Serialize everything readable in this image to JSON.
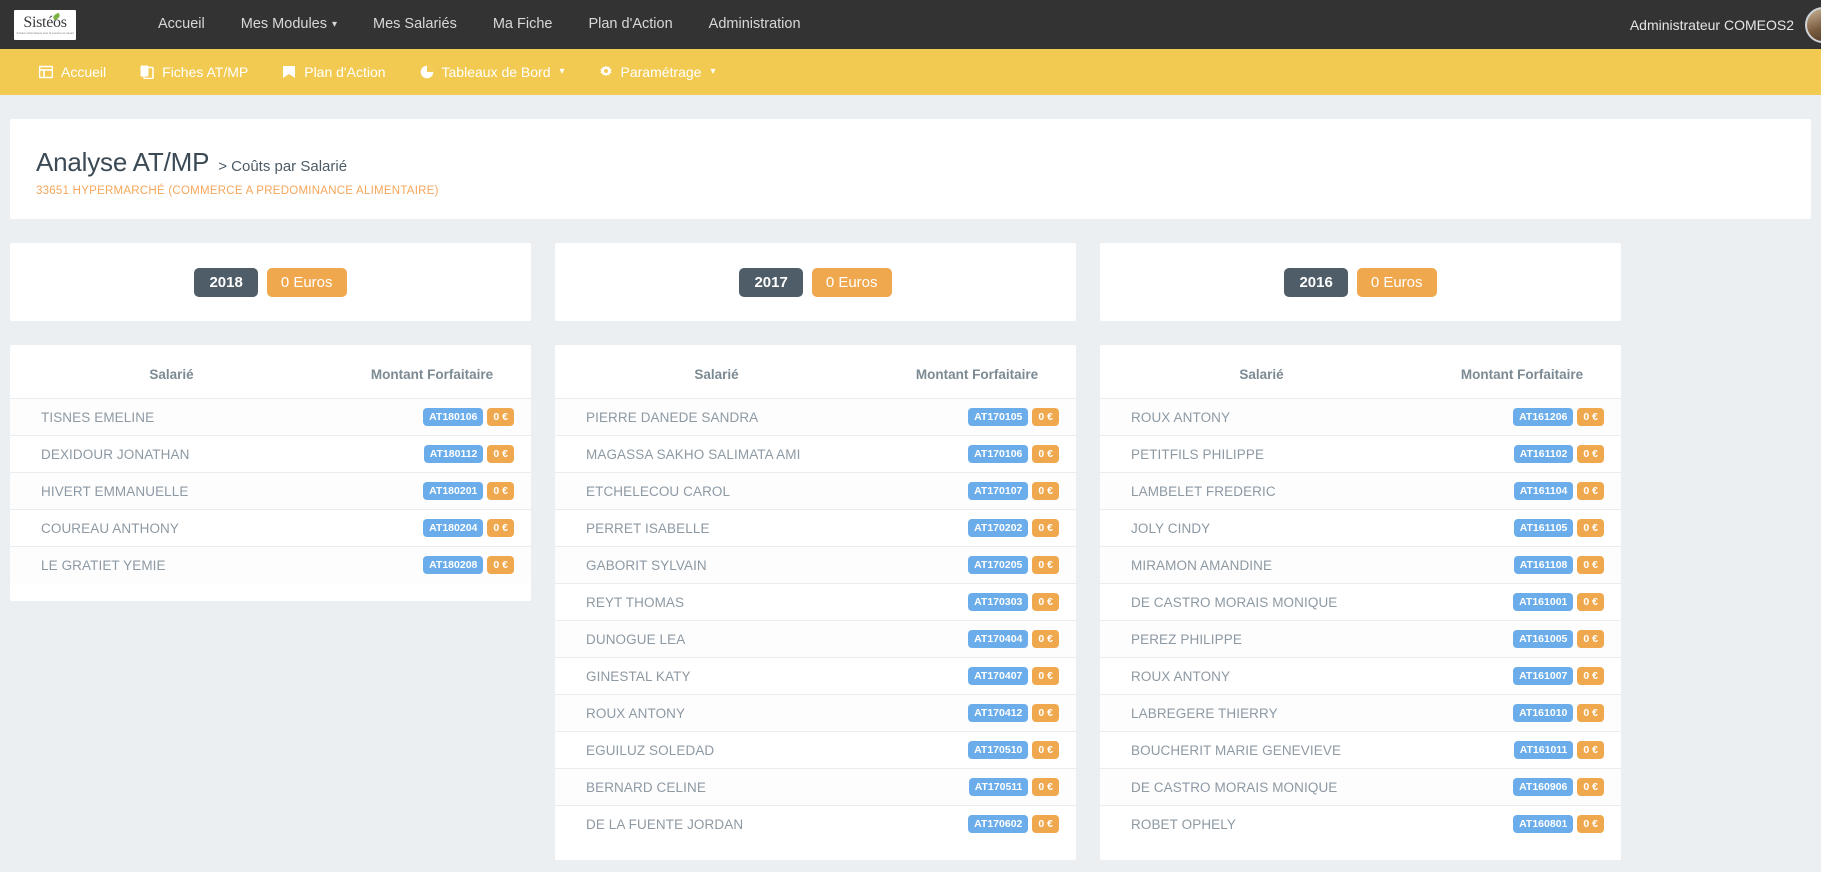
{
  "topnav": {
    "logo": {
      "word": "Sistéos",
      "tagline": "Solution informatique pour la sécurité au travail",
      "icon": "leaf-icon"
    },
    "links": [
      {
        "label": "Accueil",
        "has_caret": false
      },
      {
        "label": "Mes Modules",
        "has_caret": true
      },
      {
        "label": "Mes Salariés",
        "has_caret": false
      },
      {
        "label": "Ma Fiche",
        "has_caret": false
      },
      {
        "label": "Plan d'Action",
        "has_caret": false
      },
      {
        "label": "Administration",
        "has_caret": false
      }
    ],
    "user": "Administrateur COMEOS2"
  },
  "subnav": {
    "items": [
      {
        "label": "Accueil",
        "icon": "home-icon",
        "has_caret": false
      },
      {
        "label": "Fiches AT/MP",
        "icon": "documents-icon",
        "has_caret": false
      },
      {
        "label": "Plan d'Action",
        "icon": "book-icon",
        "has_caret": false
      },
      {
        "label": "Tableaux de Bord",
        "icon": "pie-chart-icon",
        "has_caret": true
      },
      {
        "label": "Paramétrage",
        "icon": "gear-icon",
        "has_caret": true
      }
    ]
  },
  "header": {
    "title": "Analyse AT/MP",
    "breadcrumb": "> Coûts par Salarié",
    "establishment": "33651 HYPERMARCHÉ (COMMERCE A PREDOMINANCE ALIMENTAIRE)"
  },
  "colors": {
    "subnav_bg": "#f2ca51",
    "topnav_bg": "#333333",
    "accent_orange": "#f0a84e",
    "accent_blue": "#6aadea",
    "year_pill": "#4e5d67"
  },
  "table_headers": {
    "name": "Salarié",
    "amount": "Montant Forfaitaire"
  },
  "columns": [
    {
      "year": "2018",
      "total": "0 Euros",
      "rows": [
        {
          "name": "TISNES EMELINE",
          "code": "AT180106",
          "amount": "0 €"
        },
        {
          "name": "DEXIDOUR JONATHAN",
          "code": "AT180112",
          "amount": "0 €"
        },
        {
          "name": "HIVERT EMMANUELLE",
          "code": "AT180201",
          "amount": "0 €"
        },
        {
          "name": "COUREAU ANTHONY",
          "code": "AT180204",
          "amount": "0 €"
        },
        {
          "name": "LE GRATIET YEMIE",
          "code": "AT180208",
          "amount": "0 €"
        }
      ]
    },
    {
      "year": "2017",
      "total": "0 Euros",
      "rows": [
        {
          "name": "PIERRE DANEDE SANDRA",
          "code": "AT170105",
          "amount": "0 €"
        },
        {
          "name": "MAGASSA SAKHO SALIMATA AMI",
          "code": "AT170106",
          "amount": "0 €"
        },
        {
          "name": "ETCHELECOU CAROL",
          "code": "AT170107",
          "amount": "0 €"
        },
        {
          "name": "PERRET ISABELLE",
          "code": "AT170202",
          "amount": "0 €"
        },
        {
          "name": "GABORIT SYLVAIN",
          "code": "AT170205",
          "amount": "0 €"
        },
        {
          "name": "REYT THOMAS",
          "code": "AT170303",
          "amount": "0 €"
        },
        {
          "name": "DUNOGUE LEA",
          "code": "AT170404",
          "amount": "0 €"
        },
        {
          "name": "GINESTAL KATY",
          "code": "AT170407",
          "amount": "0 €"
        },
        {
          "name": "ROUX ANTONY",
          "code": "AT170412",
          "amount": "0 €"
        },
        {
          "name": "EGUILUZ SOLEDAD",
          "code": "AT170510",
          "amount": "0 €"
        },
        {
          "name": "BERNARD CELINE",
          "code": "AT170511",
          "amount": "0 €"
        },
        {
          "name": "DE LA FUENTE JORDAN",
          "code": "AT170602",
          "amount": "0 €"
        }
      ]
    },
    {
      "year": "2016",
      "total": "0 Euros",
      "rows": [
        {
          "name": "ROUX ANTONY",
          "code": "AT161206",
          "amount": "0 €"
        },
        {
          "name": "PETITFILS PHILIPPE",
          "code": "AT161102",
          "amount": "0 €"
        },
        {
          "name": "LAMBELET FREDERIC",
          "code": "AT161104",
          "amount": "0 €"
        },
        {
          "name": "JOLY CINDY",
          "code": "AT161105",
          "amount": "0 €"
        },
        {
          "name": "MIRAMON AMANDINE",
          "code": "AT161108",
          "amount": "0 €"
        },
        {
          "name": "DE CASTRO MORAIS MONIQUE",
          "code": "AT161001",
          "amount": "0 €"
        },
        {
          "name": "PEREZ PHILIPPE",
          "code": "AT161005",
          "amount": "0 €"
        },
        {
          "name": "ROUX ANTONY",
          "code": "AT161007",
          "amount": "0 €"
        },
        {
          "name": "LABREGERE THIERRY",
          "code": "AT161010",
          "amount": "0 €"
        },
        {
          "name": "BOUCHERIT MARIE GENEVIEVE",
          "code": "AT161011",
          "amount": "0 €"
        },
        {
          "name": "DE CASTRO MORAIS MONIQUE",
          "code": "AT160906",
          "amount": "0 €"
        },
        {
          "name": "ROBET OPHELY",
          "code": "AT160801",
          "amount": "0 €"
        }
      ]
    }
  ]
}
